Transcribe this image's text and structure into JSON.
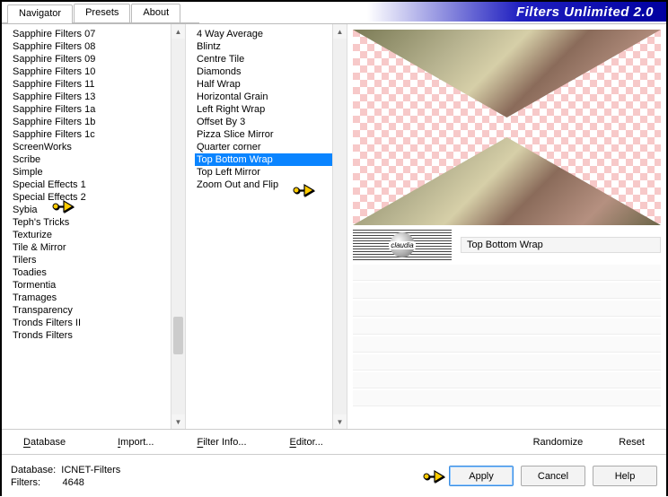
{
  "title": "Filters Unlimited 2.0",
  "tabs": [
    "Navigator",
    "Presets",
    "About"
  ],
  "activeTab": 0,
  "categories": [
    "Sapphire Filters 07",
    "Sapphire Filters 08",
    "Sapphire Filters 09",
    "Sapphire Filters 10",
    "Sapphire Filters 11",
    "Sapphire Filters 13",
    "Sapphire Filters 1a",
    "Sapphire Filters 1b",
    "Sapphire Filters 1c",
    "ScreenWorks",
    "Scribe",
    "Simple",
    "Special Effects 1",
    "Special Effects 2",
    "Sybia",
    "Teph's Tricks",
    "Texturize",
    "Tile & Mirror",
    "Tilers",
    "Toadies",
    "Tormentia",
    "Tramages",
    "Transparency",
    "Tronds Filters II",
    "Tronds Filters"
  ],
  "filters": [
    "4 Way Average",
    "Blintz",
    "Centre Tile",
    "Diamonds",
    "Half Wrap",
    "Horizontal Grain",
    "Left Right Wrap",
    "Offset By 3",
    "Pizza Slice Mirror",
    "Quarter corner",
    "Top Bottom Wrap",
    "Top Left Mirror",
    "Zoom Out and Flip"
  ],
  "selectedFilterIndex": 10,
  "currentFilterName": "Top Bottom Wrap",
  "logoText": "claudia",
  "toolbar": {
    "database": "Database",
    "import": "Import...",
    "filterInfo": "Filter Info...",
    "editor": "Editor...",
    "randomize": "Randomize",
    "reset": "Reset"
  },
  "meta": {
    "dbLabel": "Database:",
    "dbValue": "ICNET-Filters",
    "filtersLabel": "Filters:",
    "filtersValue": "4648"
  },
  "buttons": {
    "apply": "Apply",
    "cancel": "Cancel",
    "help": "Help"
  }
}
